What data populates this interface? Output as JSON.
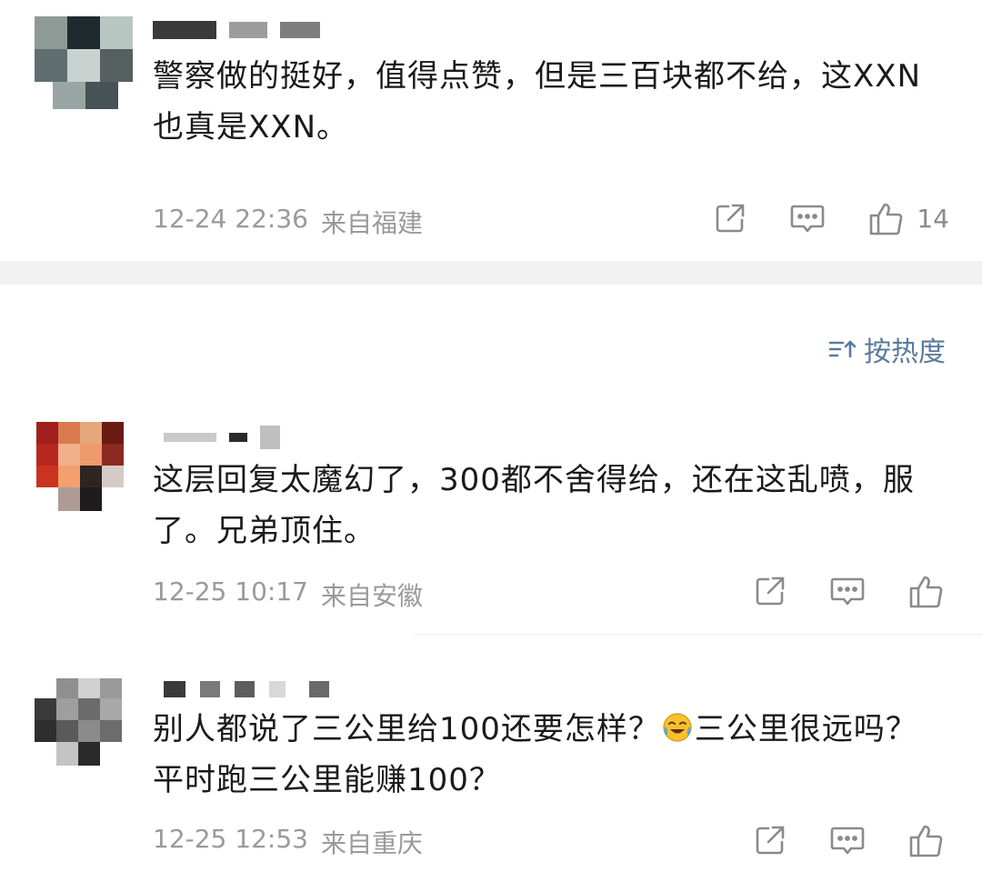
{
  "comments": [
    {
      "text": "警察做的挺好，值得点赞，但是三百块都不给，这XXN也真是XXN。",
      "time": "12-24 22:36",
      "location": "来自福建",
      "likes": "14"
    },
    {
      "text": "这层回复太魔幻了，300都不舍得给，还在这乱喷，服了。兄弟顶住。",
      "time": "12-25 10:17",
      "location": "来自安徽"
    },
    {
      "text_before_emoji": "别人都说了三公里给100还要怎样？",
      "text_after_emoji": "三公里很远吗？平时跑三公里能赚100？",
      "time": "12-25 12:53",
      "location": "来自重庆"
    }
  ],
  "sort": {
    "label": "按热度"
  },
  "icons": {
    "share": "share-icon",
    "comment": "comment-icon",
    "like": "thumbs-up-icon",
    "sort": "sort-icon",
    "emoji": "laughing-crying-emoji"
  },
  "colors": {
    "text": "#1a1a1a",
    "meta": "#9a9a9a",
    "accent": "#5b7a9d",
    "divider": "#f2f2f2"
  }
}
